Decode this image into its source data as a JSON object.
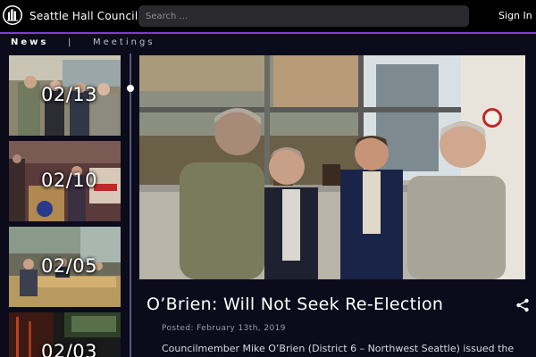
{
  "header": {
    "title": "Seattle Hall Council",
    "search_placeholder": "Search ...",
    "signin_label": "Sign In",
    "logo_icon": "seattle-seal-icon"
  },
  "nav": {
    "news_label": "News",
    "separator": "|",
    "meetings_label": "Meetings"
  },
  "timeline": {
    "items": [
      {
        "date": "02/13"
      },
      {
        "date": "02/10"
      },
      {
        "date": "02/05"
      },
      {
        "date": "02/03"
      }
    ]
  },
  "article": {
    "headline": "O’Brien: Will Not Seek Re-Election",
    "posted": "Posted: February 13th, 2019",
    "excerpt": "Councilmember Mike O’Brien (District 6 – Northwest Seattle) issued the",
    "share_icon": "share-icon"
  },
  "colors": {
    "background": "#0b0b1c",
    "topbar": "#000000",
    "accent": "#7b3ddb"
  }
}
